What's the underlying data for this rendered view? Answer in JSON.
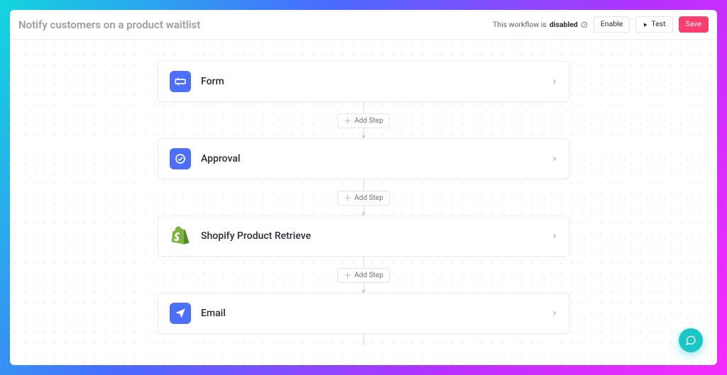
{
  "header": {
    "title": "Notify customers on a product waitlist",
    "status_prefix": "This workflow is",
    "status_value": "disabled",
    "enable_label": "Enable",
    "test_label": "Test",
    "save_label": "Save"
  },
  "flow": {
    "add_step_label": "Add Step",
    "steps": [
      {
        "label": "Form",
        "icon": "form",
        "icon_name": "form-icon",
        "color": "blue"
      },
      {
        "label": "Approval",
        "icon": "approval",
        "icon_name": "approval-icon",
        "color": "blue"
      },
      {
        "label": "Shopify Product Retrieve",
        "icon": "shopify",
        "icon_name": "shopify-icon",
        "color": "green"
      },
      {
        "label": "Email",
        "icon": "email",
        "icon_name": "email-icon",
        "color": "blue"
      }
    ]
  },
  "icons": {
    "clock": "clock-icon",
    "play": "play-icon",
    "chevron": "chevron-right-icon",
    "plus": "plus-icon",
    "chat": "chat-bubble-icon"
  }
}
